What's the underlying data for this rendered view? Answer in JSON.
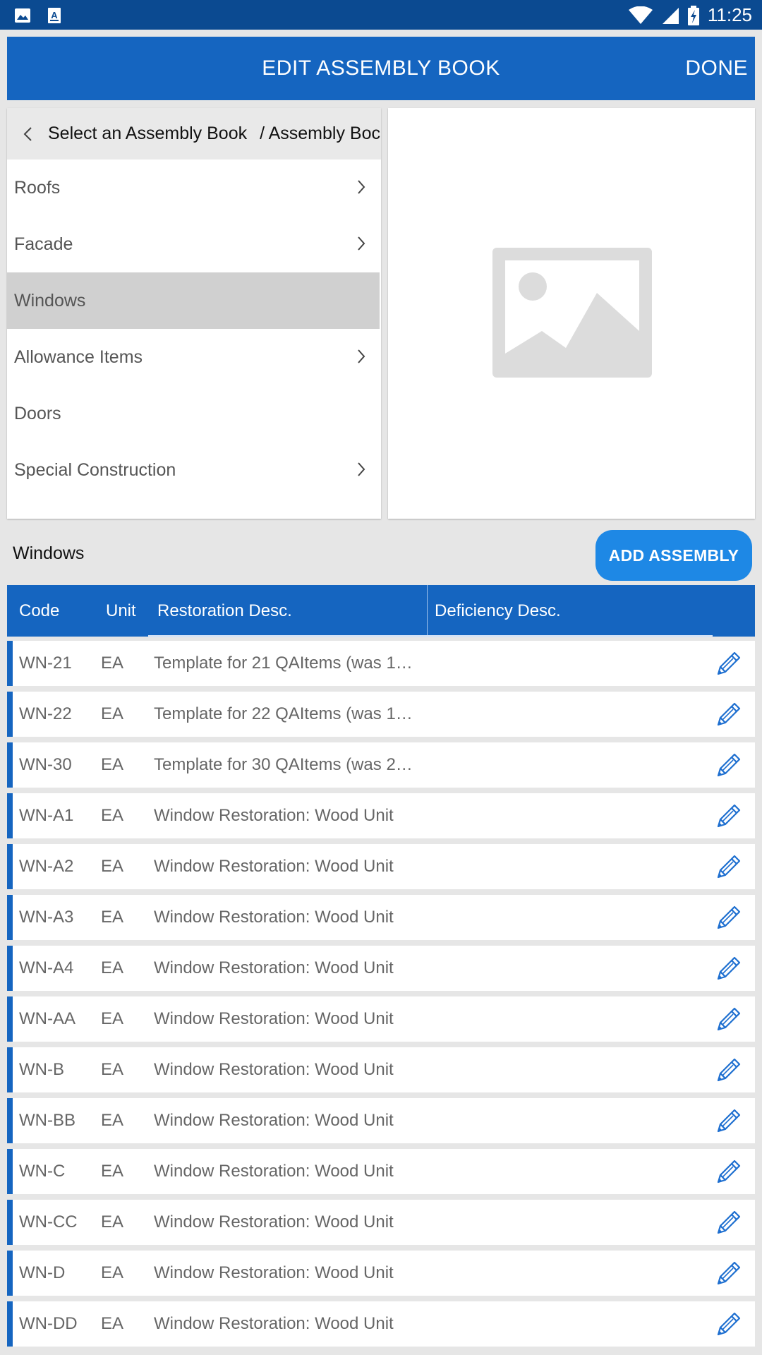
{
  "status_bar": {
    "time": "11:25",
    "left_icons": [
      "gallery-icon",
      "text-icon"
    ],
    "right_icons": [
      "wifi-icon",
      "signal-icon",
      "battery-charging-icon"
    ]
  },
  "appbar": {
    "title": "EDIT ASSEMBLY BOOK",
    "done_label": "DONE"
  },
  "breadcrumb": {
    "current": "Select an Assembly Book",
    "next": "/ Assembly Boc"
  },
  "menu": {
    "items": [
      {
        "label": "Roofs",
        "has_chevron": true
      },
      {
        "label": "Facade",
        "has_chevron": true
      },
      {
        "label": "Windows",
        "has_chevron": false,
        "selected": true
      },
      {
        "label": "Allowance Items",
        "has_chevron": true
      },
      {
        "label": "Doors",
        "has_chevron": false
      },
      {
        "label": "Special Construction",
        "has_chevron": true
      }
    ]
  },
  "section": {
    "title": "Windows",
    "add_button": "ADD ASSEMBLY"
  },
  "table": {
    "headers": {
      "code": "Code",
      "unit": "Unit",
      "restoration": "Restoration Desc.",
      "deficiency": "Deficiency Desc."
    },
    "rows": [
      {
        "code": "WN-21",
        "unit": "EA",
        "desc": "Template for 21 QAItems (was 1…"
      },
      {
        "code": "WN-22",
        "unit": "EA",
        "desc": "Template for 22 QAItems (was 1…"
      },
      {
        "code": "WN-30",
        "unit": "EA",
        "desc": "Template for 30 QAItems (was 2…"
      },
      {
        "code": "WN-A1",
        "unit": "EA",
        "desc": "Window Restoration: Wood Unit"
      },
      {
        "code": "WN-A2",
        "unit": "EA",
        "desc": "Window Restoration: Wood Unit"
      },
      {
        "code": "WN-A3",
        "unit": "EA",
        "desc": "Window Restoration: Wood Unit"
      },
      {
        "code": "WN-A4",
        "unit": "EA",
        "desc": "Window Restoration: Wood Unit"
      },
      {
        "code": "WN-AA",
        "unit": "EA",
        "desc": "Window Restoration: Wood Unit"
      },
      {
        "code": "WN-B",
        "unit": "EA",
        "desc": "Window Restoration: Wood Unit"
      },
      {
        "code": "WN-BB",
        "unit": "EA",
        "desc": "Window Restoration: Wood Unit"
      },
      {
        "code": "WN-C",
        "unit": "EA",
        "desc": "Window Restoration: Wood Unit"
      },
      {
        "code": "WN-CC",
        "unit": "EA",
        "desc": "Window Restoration: Wood Unit"
      },
      {
        "code": "WN-D",
        "unit": "EA",
        "desc": "Window Restoration: Wood Unit"
      },
      {
        "code": "WN-DD",
        "unit": "EA",
        "desc": "Window Restoration: Wood Unit"
      }
    ]
  },
  "colors": {
    "primary": "#1565c0",
    "status_bar": "#0b4a91",
    "button": "#1e88e5",
    "background": "#e6e6e6"
  }
}
